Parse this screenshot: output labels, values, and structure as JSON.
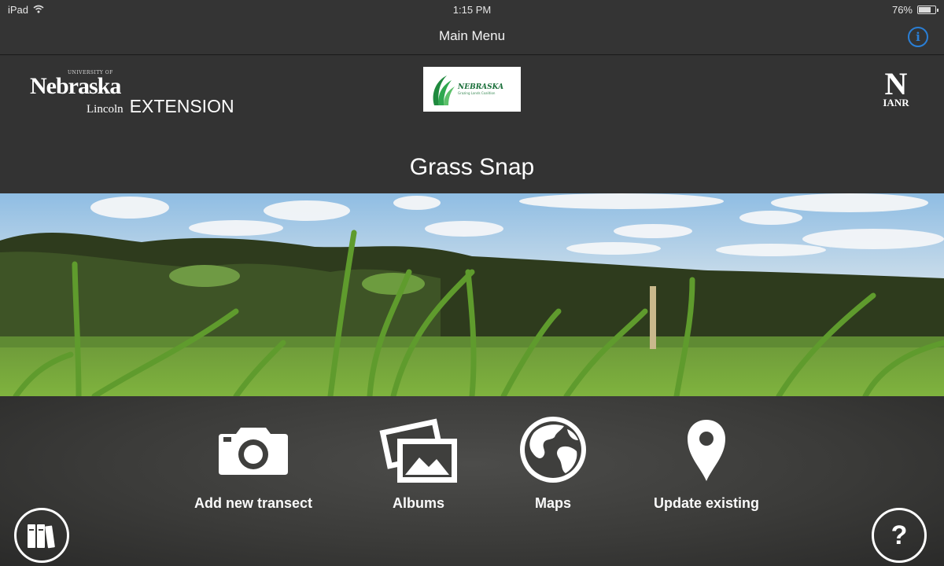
{
  "status_bar": {
    "device": "iPad",
    "time": "1:15 PM",
    "battery_text": "76%",
    "battery_level": 0.76
  },
  "nav": {
    "title": "Main Menu",
    "info_icon": "info-icon"
  },
  "header": {
    "left_logo": {
      "top": "UNIVERSITY OF",
      "main": "Nebraska",
      "sub": "Lincoln",
      "extension": "EXTENSION"
    },
    "center_logo": {
      "name": "NEBRASKA",
      "small": "Grazing Lands Coalition"
    },
    "right_logo": {
      "letter": "N",
      "text": "IANR"
    },
    "app_title": "Grass Snap"
  },
  "menu": [
    {
      "label": "Add new transect",
      "icon": "camera-icon"
    },
    {
      "label": "Albums",
      "icon": "photos-icon"
    },
    {
      "label": "Maps",
      "icon": "globe-icon"
    },
    {
      "label": "Update existing",
      "icon": "map-pin-icon"
    }
  ],
  "corner_buttons": {
    "left_icon": "books-icon",
    "right_icon": "help-icon",
    "right_glyph": "?"
  }
}
